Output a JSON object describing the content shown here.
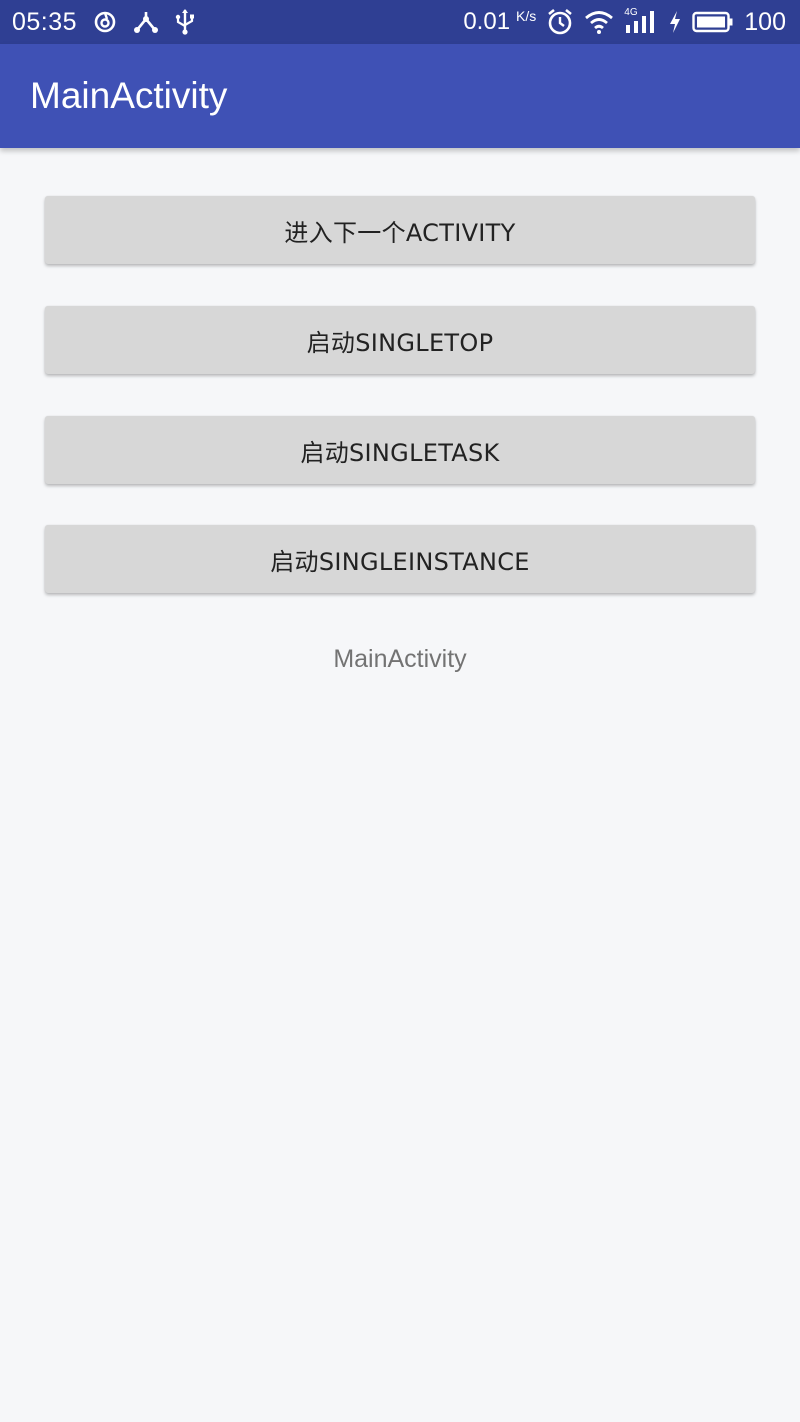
{
  "status_bar": {
    "time": "05:35",
    "network_speed": "0.01",
    "network_speed_unit": "K/s",
    "network_type": "4G",
    "battery_percent": "100",
    "icons": [
      "netease-music-icon",
      "share-icon",
      "usb-icon",
      "alarm-clock-icon",
      "wifi-icon",
      "cellular-signal-icon",
      "charging-icon",
      "battery-icon"
    ]
  },
  "app_bar": {
    "title": "MainActivity",
    "color": "#3f51b5"
  },
  "buttons": [
    {
      "label": "进入下一个ACTIVITY"
    },
    {
      "label": "启动SINGLETOP"
    },
    {
      "label": "启动SINGLETASK"
    },
    {
      "label": "启动SINGLEINSTANCE"
    }
  ],
  "main": {
    "activity_label": "MainActivity"
  }
}
